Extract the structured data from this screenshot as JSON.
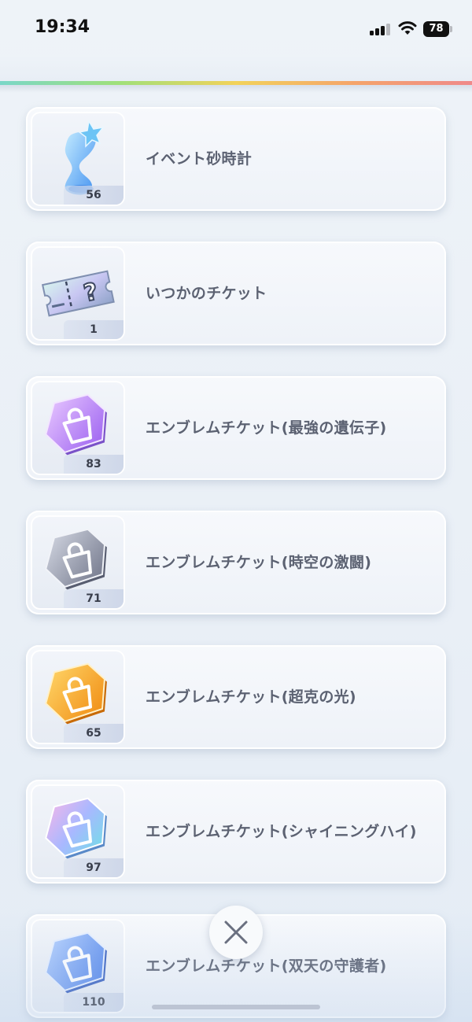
{
  "status_bar": {
    "time": "19:34",
    "battery_level": "78",
    "signal_bars": 3
  },
  "items": [
    {
      "name": "イベント砂時計",
      "count": "56",
      "icon": "hourglass-icon"
    },
    {
      "name": "いつかのチケット",
      "count": "1",
      "icon": "mystery-ticket-icon"
    },
    {
      "name": "エンブレムチケット(最強の遺伝子)",
      "count": "83",
      "icon": "emblem-ticket-purple-icon"
    },
    {
      "name": "エンブレムチケット(時空の激闘)",
      "count": "71",
      "icon": "emblem-ticket-gray-icon"
    },
    {
      "name": "エンブレムチケット(超克の光)",
      "count": "65",
      "icon": "emblem-ticket-orange-icon"
    },
    {
      "name": "エンブレムチケット(シャイニングハイ)",
      "count": "97",
      "icon": "emblem-ticket-rainbow-icon"
    },
    {
      "name": "エンブレムチケット(双天の守護者)",
      "count": "110",
      "icon": "emblem-ticket-blue-icon"
    }
  ],
  "colors": {
    "emblem_purple": "#b27cf0",
    "emblem_gray": "#8a90a3",
    "emblem_orange": "#f5a623",
    "emblem_blue": "#6f9cf2",
    "text": "#5c6272"
  },
  "close_icon": "close-icon"
}
